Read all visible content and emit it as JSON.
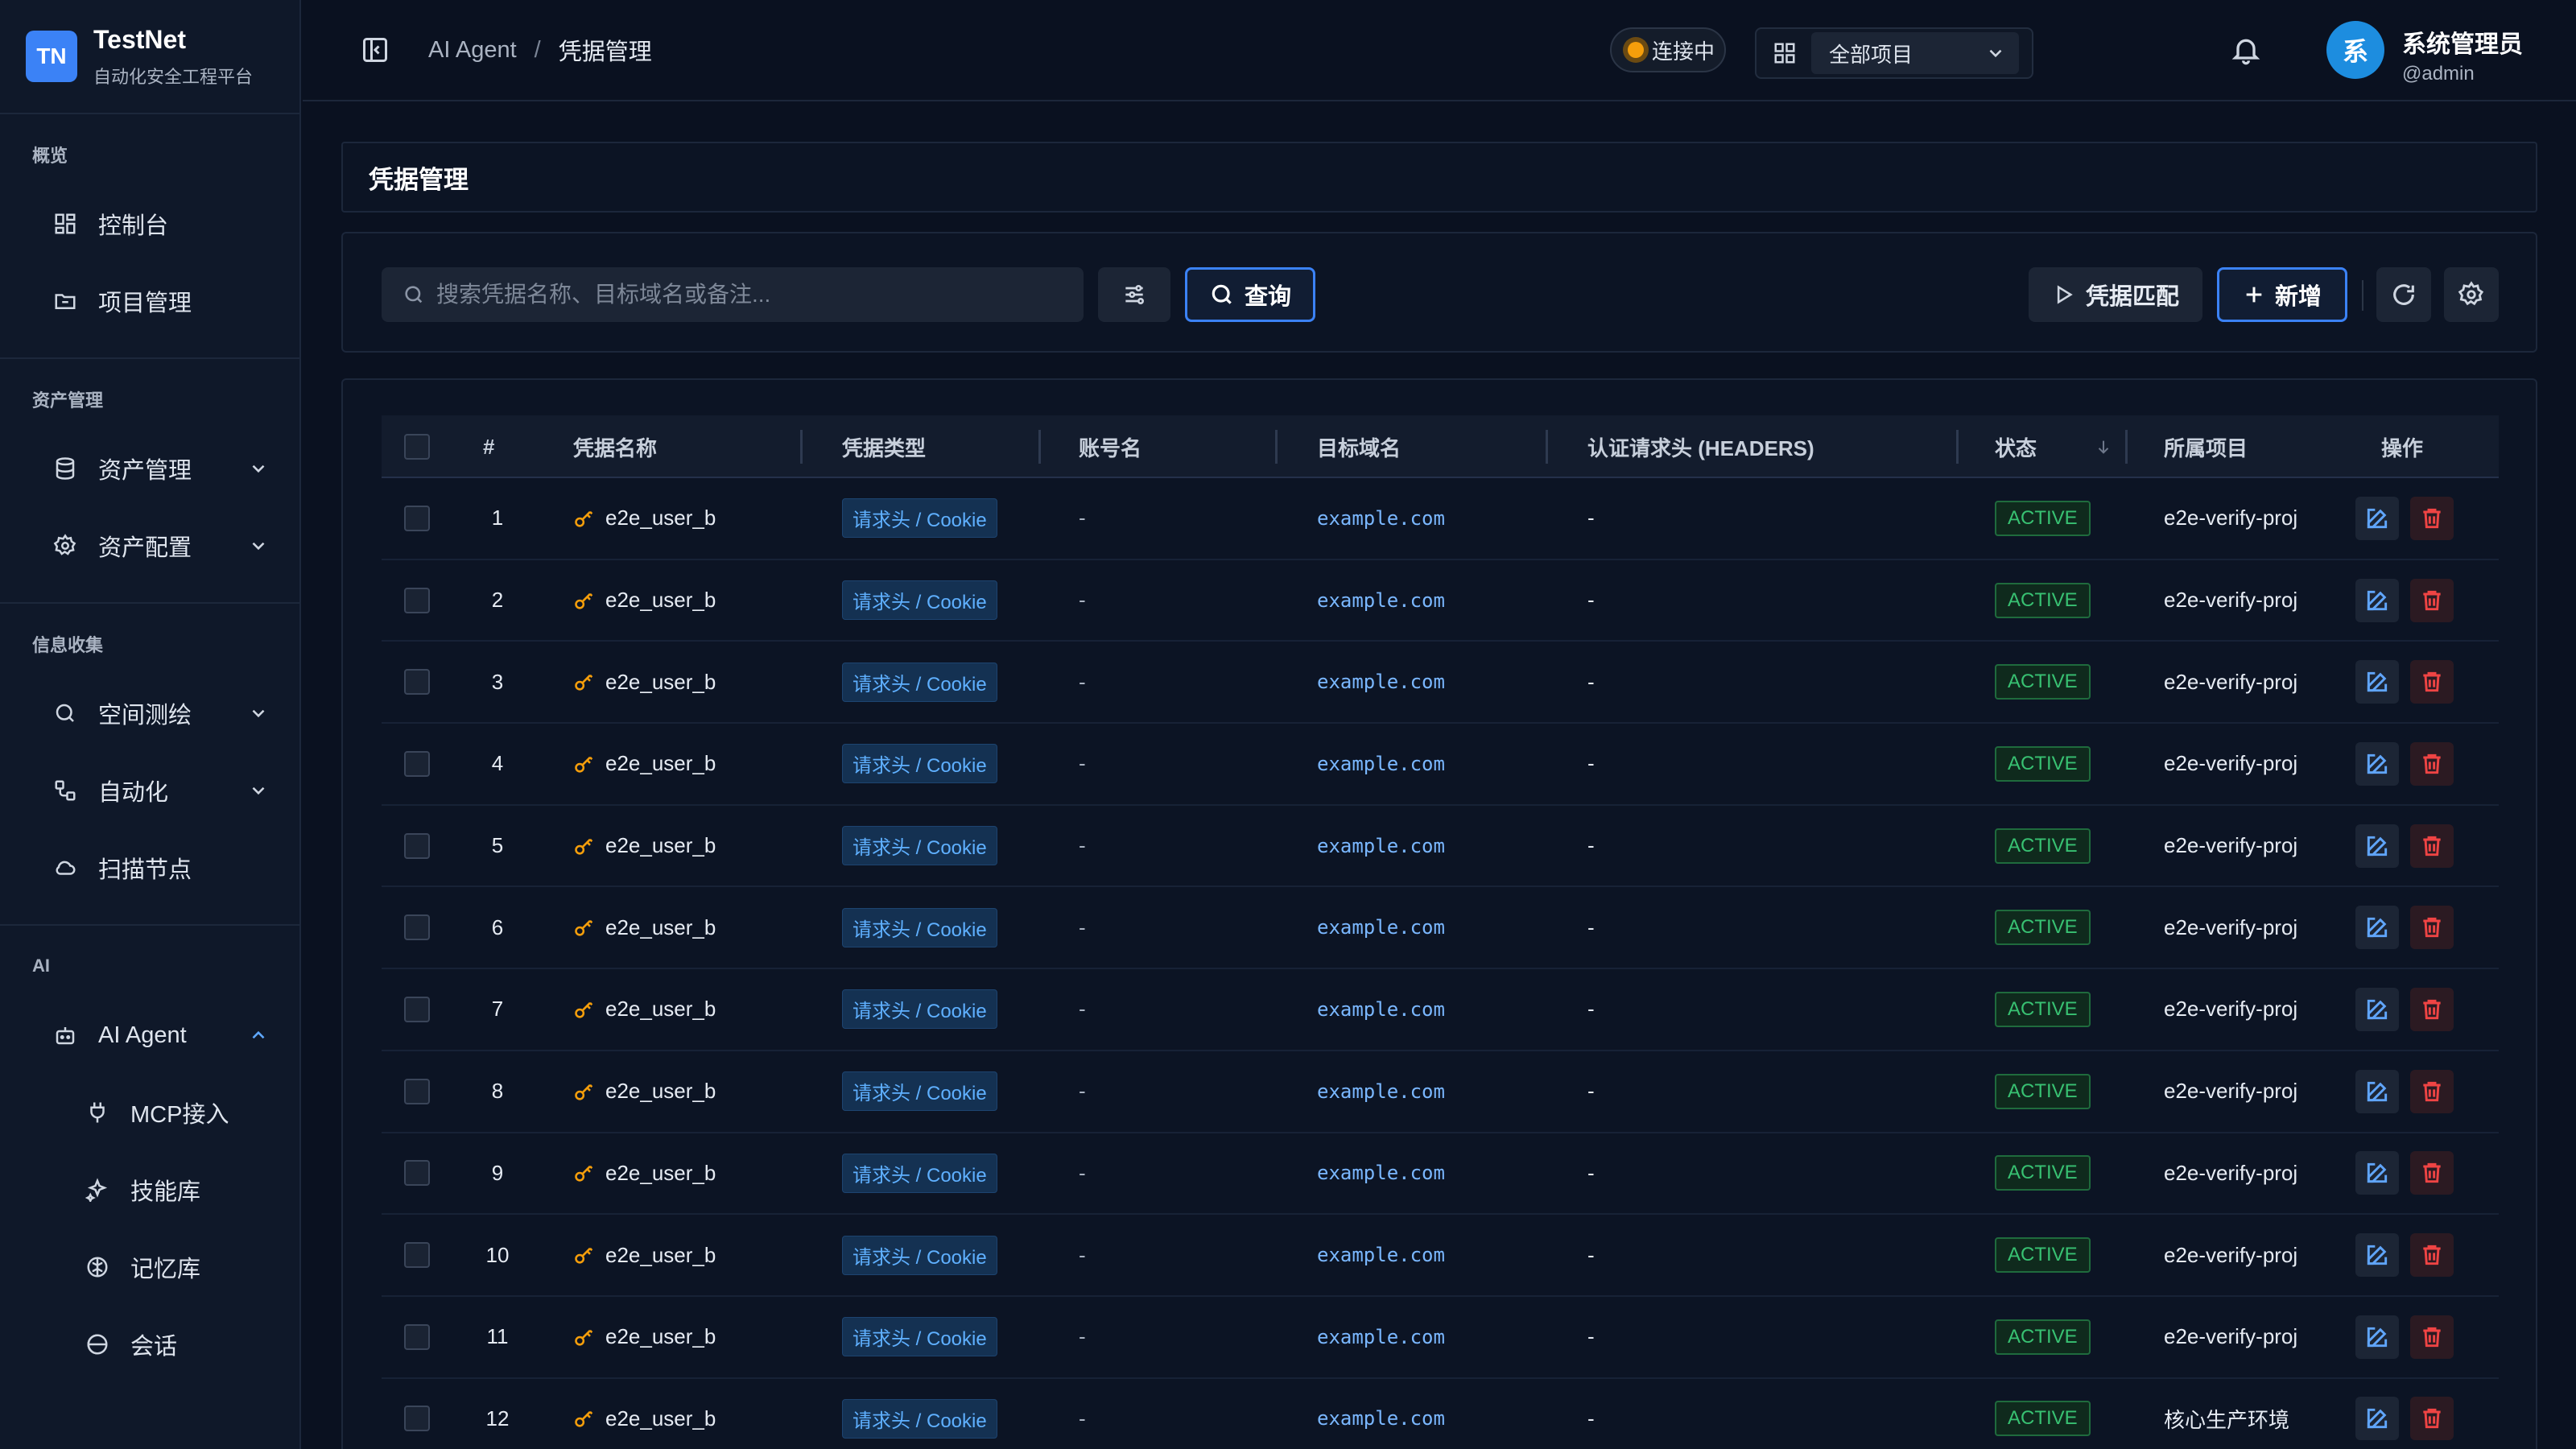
{
  "brand": {
    "logo": "TN",
    "name": "TestNet",
    "subtitle": "自动化安全工程平台"
  },
  "sidebar": {
    "sections": [
      {
        "label": "概览",
        "items": [
          {
            "label": "控制台",
            "icon": "dashboard-icon"
          },
          {
            "label": "项目管理",
            "icon": "folder-icon"
          }
        ]
      },
      {
        "label": "资产管理",
        "items": [
          {
            "label": "资产管理",
            "icon": "database-icon",
            "expandable": true
          },
          {
            "label": "资产配置",
            "icon": "gear-icon",
            "expandable": true
          }
        ]
      },
      {
        "label": "信息收集",
        "items": [
          {
            "label": "空间测绘",
            "icon": "search-icon",
            "expandable": true
          },
          {
            "label": "自动化",
            "icon": "workflow-icon",
            "expandable": true
          },
          {
            "label": "扫描节点",
            "icon": "cloud-icon"
          }
        ]
      },
      {
        "label": "AI",
        "items": [
          {
            "label": "AI Agent",
            "icon": "robot-icon",
            "expanded": true
          },
          {
            "label": "MCP接入",
            "icon": "plug-icon",
            "sub": true
          },
          {
            "label": "技能库",
            "icon": "sparkles-icon",
            "sub": true
          },
          {
            "label": "记忆库",
            "icon": "brain-icon",
            "sub": true
          },
          {
            "label": "会话",
            "icon": "chat-icon",
            "sub": true
          }
        ]
      }
    ]
  },
  "header": {
    "breadcrumb": [
      "AI Agent",
      "凭据管理"
    ],
    "connection": "连接中",
    "project_select": "全部项目",
    "user_name": "系统管理员",
    "user_handle": "@admin",
    "avatar": "系"
  },
  "page": {
    "title": "凭据管理",
    "search_placeholder": "搜索凭据名称、目标域名或备注...",
    "query_label": "查询",
    "match_label": "凭据匹配",
    "add_label": "新增"
  },
  "table": {
    "columns": [
      "#",
      "凭据名称",
      "凭据类型",
      "账号名",
      "目标域名",
      "认证请求头 (HEADERS)",
      "状态",
      "所属项目",
      "操作"
    ],
    "rows": [
      {
        "idx": "1",
        "name": "e2e_user_b",
        "type": "请求头 / Cookie",
        "account": "-",
        "domain": "example.com",
        "headers": "-",
        "status": "ACTIVE",
        "project": "e2e-verify-proj"
      },
      {
        "idx": "2",
        "name": "e2e_user_b",
        "type": "请求头 / Cookie",
        "account": "-",
        "domain": "example.com",
        "headers": "-",
        "status": "ACTIVE",
        "project": "e2e-verify-proj"
      },
      {
        "idx": "3",
        "name": "e2e_user_b",
        "type": "请求头 / Cookie",
        "account": "-",
        "domain": "example.com",
        "headers": "-",
        "status": "ACTIVE",
        "project": "e2e-verify-proj"
      },
      {
        "idx": "4",
        "name": "e2e_user_b",
        "type": "请求头 / Cookie",
        "account": "-",
        "domain": "example.com",
        "headers": "-",
        "status": "ACTIVE",
        "project": "e2e-verify-proj"
      },
      {
        "idx": "5",
        "name": "e2e_user_b",
        "type": "请求头 / Cookie",
        "account": "-",
        "domain": "example.com",
        "headers": "-",
        "status": "ACTIVE",
        "project": "e2e-verify-proj"
      },
      {
        "idx": "6",
        "name": "e2e_user_b",
        "type": "请求头 / Cookie",
        "account": "-",
        "domain": "example.com",
        "headers": "-",
        "status": "ACTIVE",
        "project": "e2e-verify-proj"
      },
      {
        "idx": "7",
        "name": "e2e_user_b",
        "type": "请求头 / Cookie",
        "account": "-",
        "domain": "example.com",
        "headers": "-",
        "status": "ACTIVE",
        "project": "e2e-verify-proj"
      },
      {
        "idx": "8",
        "name": "e2e_user_b",
        "type": "请求头 / Cookie",
        "account": "-",
        "domain": "example.com",
        "headers": "-",
        "status": "ACTIVE",
        "project": "e2e-verify-proj"
      },
      {
        "idx": "9",
        "name": "e2e_user_b",
        "type": "请求头 / Cookie",
        "account": "-",
        "domain": "example.com",
        "headers": "-",
        "status": "ACTIVE",
        "project": "e2e-verify-proj"
      },
      {
        "idx": "10",
        "name": "e2e_user_b",
        "type": "请求头 / Cookie",
        "account": "-",
        "domain": "example.com",
        "headers": "-",
        "status": "ACTIVE",
        "project": "e2e-verify-proj"
      },
      {
        "idx": "11",
        "name": "e2e_user_b",
        "type": "请求头 / Cookie",
        "account": "-",
        "domain": "example.com",
        "headers": "-",
        "status": "ACTIVE",
        "project": "e2e-verify-proj"
      },
      {
        "idx": "12",
        "name": "e2e_user_b",
        "type": "请求头 / Cookie",
        "account": "-",
        "domain": "example.com",
        "headers": "-",
        "status": "ACTIVE",
        "project": "核心生产环境"
      }
    ]
  },
  "colors": {
    "accent": "#3b82f6",
    "active": "#38c172",
    "danger": "#ef4444",
    "key": "#f59e0b"
  }
}
